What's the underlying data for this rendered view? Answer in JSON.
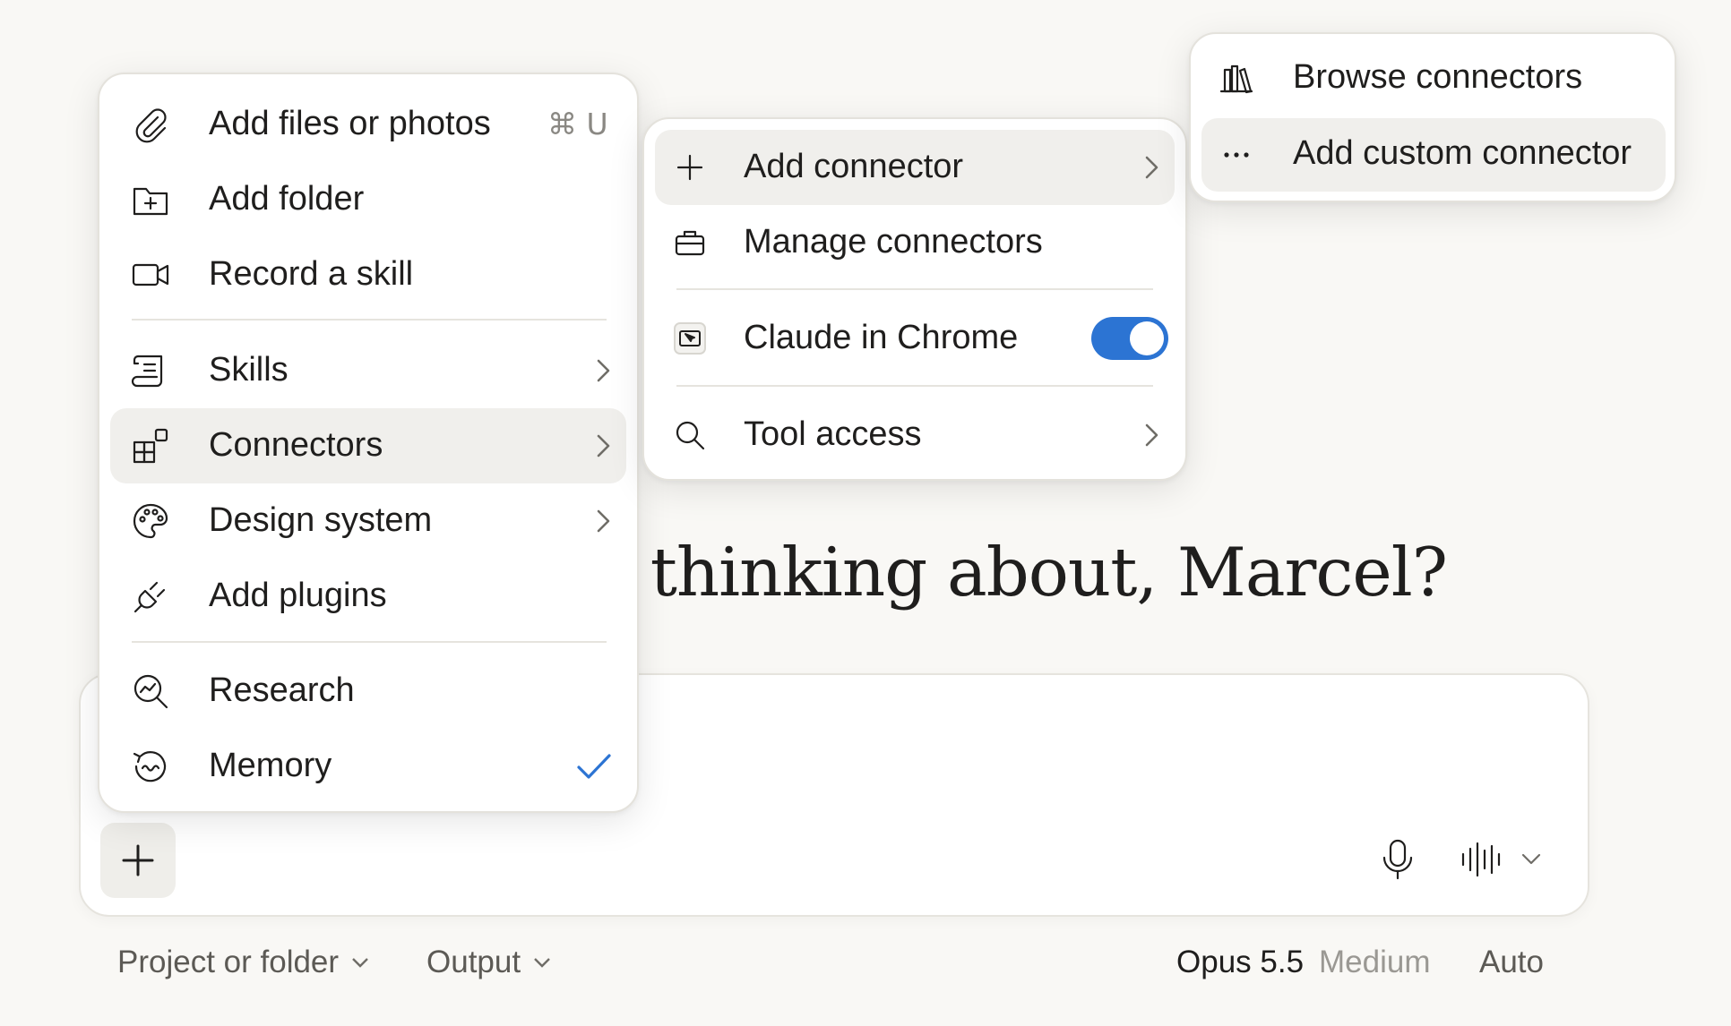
{
  "greeting": "e thinking about, Marcel?",
  "composer": {
    "plus_icon": "plus-icon",
    "mic_icon": "microphone-icon",
    "voice_icon": "waveform-icon"
  },
  "bottom_bar": {
    "project": "Project or folder",
    "output": "Output",
    "model": "Opus 5.5",
    "effort": "Medium",
    "mode": "Auto"
  },
  "main_menu": {
    "add_files": "Add files or photos",
    "add_files_shortcut": "⌘ U",
    "add_folder": "Add folder",
    "record_skill": "Record a skill",
    "skills": "Skills",
    "connectors": "Connectors",
    "design_system": "Design system",
    "add_plugins": "Add plugins",
    "research": "Research",
    "memory": "Memory",
    "memory_checked": true,
    "accent_color": "#2c74d3"
  },
  "connectors_menu": {
    "add_connector": "Add connector",
    "manage_connectors": "Manage connectors",
    "claude_in_chrome": "Claude in Chrome",
    "claude_in_chrome_enabled": true,
    "tool_access": "Tool access"
  },
  "add_connector_menu": {
    "browse": "Browse connectors",
    "custom": "Add custom connector"
  }
}
